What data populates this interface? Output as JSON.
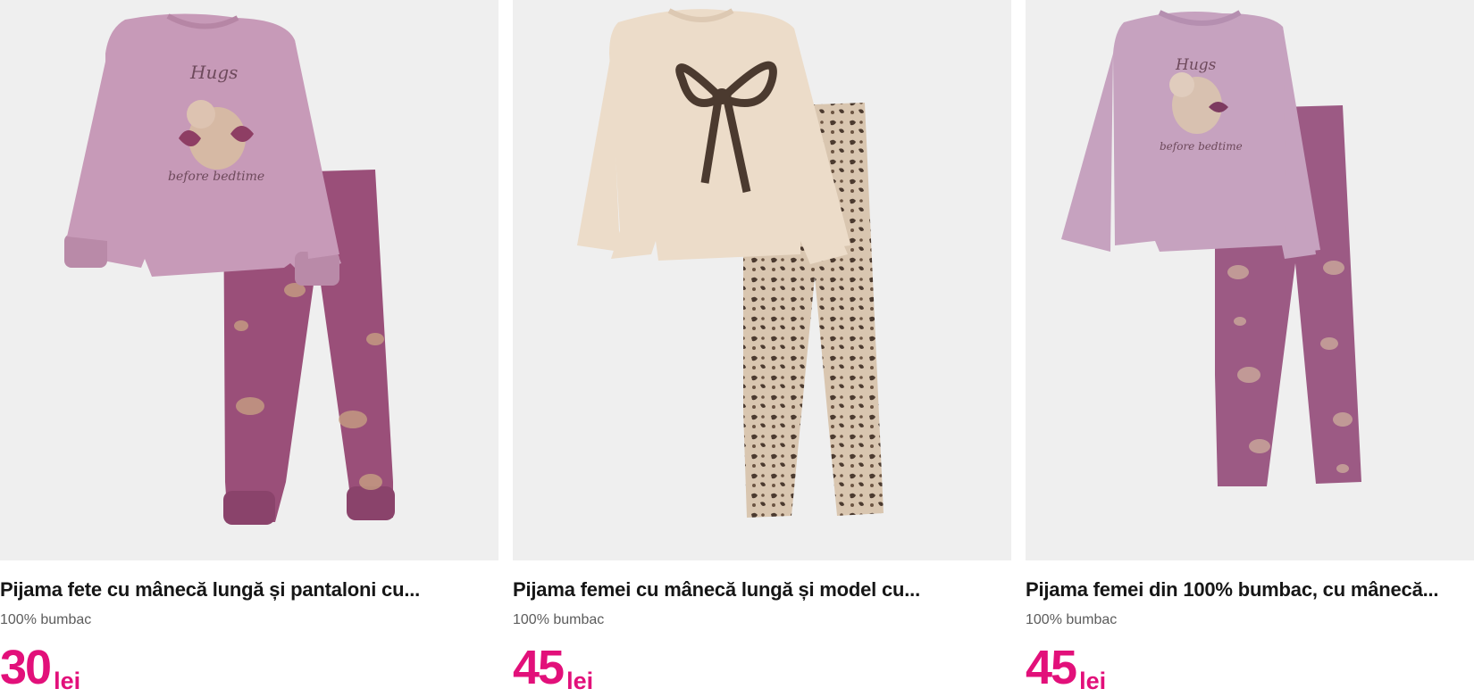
{
  "theme": {
    "price_color": "#e2107a",
    "card_image_bg": "#efefef",
    "title_color": "#161616",
    "subtitle_color": "#5c5c5c"
  },
  "products": [
    {
      "title": "Pijama fete cu mânecă lungă și pantaloni cu...",
      "material": "100% bumbac",
      "price": "30",
      "currency": "lei",
      "image": {
        "description": "mauve long-sleeve pajama top with squirrel print and matching jogger pants",
        "top_color": "#c79ab8",
        "bottom_color": "#9a4f79",
        "print_text": [
          "Hugs",
          "before bedtime"
        ]
      }
    },
    {
      "title": "Pijama femei cu mânecă lungă și model cu...",
      "material": "100% bumbac",
      "price": "45",
      "currency": "lei",
      "image": {
        "description": "cream long-sleeve pajama top with leopard print bow and leopard print pants",
        "top_color": "#ecdcc9",
        "bottom_color": "#d9c6b0",
        "print_text": []
      }
    },
    {
      "title": "Pijama femei din 100% bumbac, cu mânecă...",
      "material": "100% bumbac",
      "price": "45",
      "currency": "lei",
      "image": {
        "description": "lilac long-sleeve pajama top with squirrel print and straight squirrel-print pants",
        "top_color": "#c6a2bf",
        "bottom_color": "#9c5a84",
        "print_text": [
          "Hugs",
          "before bedtime"
        ]
      }
    }
  ]
}
